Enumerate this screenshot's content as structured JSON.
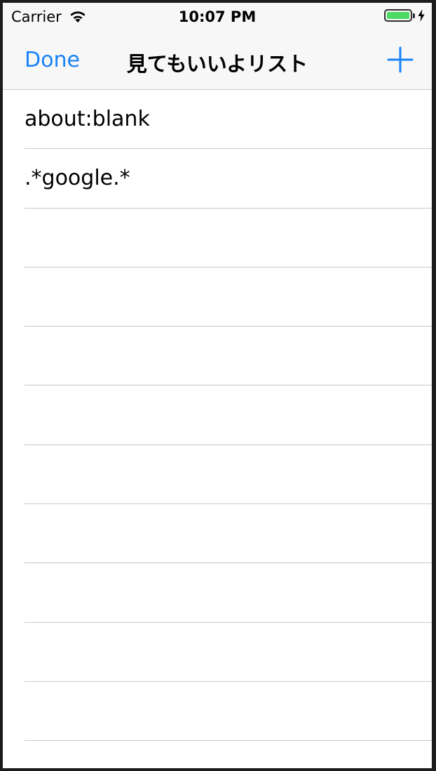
{
  "status_bar": {
    "carrier": "Carrier",
    "time": "10:07 PM",
    "battery_color": "#4cd964",
    "wifi_icon": "wifi-icon",
    "battery_icon": "battery-full-icon",
    "charging_icon": "charging-bolt-icon"
  },
  "nav": {
    "done_label": "Done",
    "title": "見てもいいよリスト",
    "add_icon": "plus-icon",
    "tint_color": "#1a82f7"
  },
  "list": {
    "items": [
      {
        "text": "about:blank"
      },
      {
        "text": ".*google.*"
      },
      {
        "text": ""
      },
      {
        "text": ""
      },
      {
        "text": ""
      },
      {
        "text": ""
      },
      {
        "text": ""
      },
      {
        "text": ""
      },
      {
        "text": ""
      },
      {
        "text": ""
      },
      {
        "text": ""
      }
    ]
  }
}
